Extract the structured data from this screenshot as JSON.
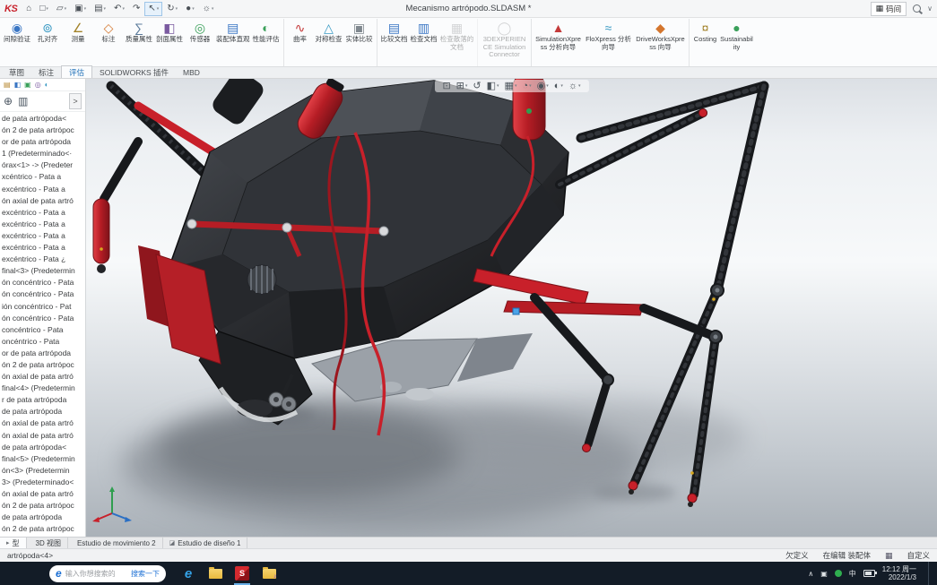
{
  "colors": {
    "accent_red": "#c8202a",
    "taskbar_bg": "#131c27",
    "selection_blue": "#4aa3e8"
  },
  "titlebar": {
    "logo": "KS",
    "title": "Mecanismo artrópodo.SLDASM *",
    "command_box": "码间",
    "keyboard_glyph": "▦",
    "search_chevron": "∨",
    "quick_icons": [
      {
        "name": "home-icon",
        "glyph": "⌂"
      },
      {
        "name": "new-document-icon",
        "glyph": "□",
        "caret": true
      },
      {
        "name": "open-icon",
        "glyph": "▱",
        "caret": true
      },
      {
        "name": "save-icon",
        "glyph": "▣",
        "caret": true
      },
      {
        "name": "print-icon",
        "glyph": "▤",
        "caret": true
      },
      {
        "name": "undo-icon",
        "glyph": "↶",
        "caret": true
      },
      {
        "name": "redo-icon",
        "glyph": "↷"
      },
      {
        "name": "select-icon",
        "glyph": "↖",
        "active": true,
        "caret": true
      },
      {
        "name": "rebuild-icon",
        "glyph": "↻",
        "caret": true
      },
      {
        "name": "appearance-sphere-icon",
        "glyph": "●",
        "caret": true
      },
      {
        "name": "options-gear-icon",
        "glyph": "☼",
        "caret": true
      }
    ]
  },
  "ribbon": {
    "buttons": [
      {
        "name": "ribbon-clearance-verification-button",
        "label": "间隙验证",
        "glyph": "◉",
        "color": "#3a76c4"
      },
      {
        "name": "ribbon-hole-alignment-button",
        "label": "孔对齐",
        "glyph": "⊚",
        "color": "#3a9ac4"
      },
      {
        "name": "ribbon-measure-button",
        "label": "测量",
        "glyph": "∠",
        "color": "#a3832a"
      },
      {
        "name": "ribbon-markup-button",
        "label": "标注",
        "glyph": "◇",
        "color": "#d4762e"
      },
      {
        "name": "ribbon-mass-properties-button",
        "label": "质量属性",
        "glyph": "∑",
        "color": "#5a7a9a"
      },
      {
        "name": "ribbon-section-properties-button",
        "label": "剖面属性",
        "glyph": "◧",
        "color": "#7a5aa0"
      },
      {
        "name": "ribbon-sensor-button",
        "label": "传感器",
        "glyph": "◎",
        "color": "#3aa05a"
      },
      {
        "name": "ribbon-assembly-visualization-button",
        "label": "装配体直观",
        "glyph": "▤",
        "color": "#3a76c4"
      },
      {
        "name": "ribbon-performance-evaluation-button",
        "label": "性能评估",
        "glyph": "◐",
        "color": "#3aa05a"
      },
      {
        "name": "ribbon-curvature-button",
        "label": "曲率",
        "glyph": "∿",
        "color": "#c43a3a",
        "sep": true
      },
      {
        "name": "ribbon-symmetry-check-button",
        "label": "对称检查",
        "glyph": "△",
        "color": "#3a9ac4"
      },
      {
        "name": "ribbon-compare-bodies-button",
        "label": "实体比较",
        "glyph": "▣",
        "color": "#80888f"
      },
      {
        "name": "ribbon-compare-documents-button",
        "label": "比较文档",
        "glyph": "▤",
        "color": "#3a76c4",
        "sep": true
      },
      {
        "name": "ribbon-check-document-button",
        "label": "检查文档",
        "glyph": "▥",
        "color": "#3a76c4"
      },
      {
        "name": "ribbon-check-scattered-documents-button",
        "label": "检查散落的文档",
        "glyph": "▦",
        "color": "#9aa0a6",
        "enabled": false
      },
      {
        "name": "ribbon-3dexperience-connector-button",
        "label": "3DEXPERIENCE Simulation Connector",
        "glyph": "◯",
        "color": "#9aa0a6",
        "enabled": false,
        "wide": true,
        "sep": true
      },
      {
        "name": "ribbon-simulationxpress-button",
        "label": "SimulationXpress 分析向导",
        "glyph": "▲",
        "color": "#c43a3a",
        "wide": true,
        "sep": true
      },
      {
        "name": "ribbon-floxpress-button",
        "label": "FloXpress 分析向导",
        "glyph": "≈",
        "color": "#3a9ac4",
        "wide": true
      },
      {
        "name": "ribbon-driveworksxpress-button",
        "label": "DriveWorksXpress 向导",
        "glyph": "◆",
        "color": "#d4762e",
        "wide": true
      },
      {
        "name": "ribbon-costing-button",
        "label": "Costing",
        "glyph": "¤",
        "color": "#a3832a",
        "sep": true
      },
      {
        "name": "ribbon-sustainability-button",
        "label": "Sustainability",
        "glyph": "●",
        "color": "#3aa05a"
      }
    ],
    "tabs": [
      {
        "name": "tab-sketch",
        "label": "草图"
      },
      {
        "name": "tab-markup",
        "label": "标注"
      },
      {
        "name": "tab-evaluate",
        "label": "评估",
        "active": true
      },
      {
        "name": "tab-solidworks-addins",
        "label": "SOLIDWORKS 插件"
      },
      {
        "name": "tab-mbd",
        "label": "MBD"
      }
    ]
  },
  "left_panel": {
    "manager_tabs": [
      {
        "name": "feature-manager-tab-icon",
        "glyph": "▤",
        "color": "#b5862e"
      },
      {
        "name": "property-manager-tab-icon",
        "glyph": "◧",
        "color": "#3a76c4"
      },
      {
        "name": "configuration-manager-tab-icon",
        "glyph": "▣",
        "color": "#3aa05a"
      },
      {
        "name": "dimxpert-manager-tab-icon",
        "glyph": "◎",
        "color": "#7a5aa0"
      },
      {
        "name": "display-manager-tab-icon",
        "glyph": "◐",
        "color": "#3a9ac4"
      }
    ],
    "tree_tools": [
      {
        "name": "tree-filter-icon",
        "glyph": "⊕"
      },
      {
        "name": "display-pane-icon",
        "glyph": "▥"
      }
    ],
    "collapse_chevron": ">",
    "tree_items": [
      "de pata artrópoda<",
      "ón 2 de pata artrópoc",
      "or de pata artrópoda",
      "1 (Predeterminado<·",
      "órax<1> -> (Predeter",
      "xcéntrico - Pata a",
      "excéntrico - Pata a",
      "ón axial de pata artró",
      "excéntrico - Pata a",
      "excéntrico - Pata a",
      "excéntrico - Pata a",
      "excéntrico - Pata a",
      "excéntrico - Pata ¿",
      "final<3> (Predetermin",
      "ón concéntrico - Pata",
      "ón concéntrico - Pata",
      "ión concéntrico - Pat",
      "ón concéntrico - Pata",
      "concéntrico - Pata",
      "oncéntrico - Pata",
      "or de pata artrópoda",
      "ón 2 de pata artrópoc",
      "ón axial de pata artró",
      "final<4> (Predetermin",
      "r de pata artrópoda",
      "de pata artrópoda",
      "ón axial de pata artró",
      "ón axial de pata artró",
      "de pata artrópoda<",
      "final<5> (Predetermin",
      "ón<3> (Predetermin",
      "3> (Predeterminado<",
      "ón axial de pata artró",
      "ón 2 de pata artrópoc",
      "de pata artrópoda",
      "ón 2 de pata artrópoc"
    ]
  },
  "viewport": {
    "hud_icons": [
      {
        "name": "zoom-fit-icon",
        "glyph": "⊡"
      },
      {
        "name": "zoom-area-icon",
        "glyph": "⊞",
        "caret": true
      },
      {
        "name": "previous-view-icon",
        "glyph": "↺"
      },
      {
        "name": "section-view-icon",
        "glyph": "◧",
        "caret": true
      },
      {
        "name": "view-orientation-icon",
        "glyph": "▦",
        "caret": true
      },
      {
        "name": "display-style-icon",
        "glyph": "◔",
        "caret": true
      },
      {
        "name": "hide-show-items-icon",
        "glyph": "◉",
        "caret": true
      },
      {
        "name": "edit-appearance-icon",
        "glyph": "◐",
        "caret": true
      },
      {
        "name": "apply-scene-icon",
        "glyph": "☼",
        "caret": true
      }
    ]
  },
  "doc_tabs": [
    {
      "name": "tab-model",
      "label": "型",
      "icon": "▸",
      "active": true
    },
    {
      "name": "tab-3d-views",
      "label": "3D 视图"
    },
    {
      "name": "tab-motion-study-2",
      "label": "Estudio de movimiento 2"
    },
    {
      "name": "tab-design-study-1",
      "label": "Estudio de diseño 1",
      "icon": "◪"
    }
  ],
  "status_bar": {
    "selection": "artrópoda<4>",
    "state": "欠定义",
    "mode": "在编辑 装配体",
    "grid_glyph": "▦",
    "customize": "自定义"
  },
  "taskbar": {
    "search_placeholder": "输入你想搜索的",
    "search_button": "搜索一下",
    "edge_glyph": "e",
    "tray_caret": "∧",
    "tray_app_glyph": "▣",
    "language": "中",
    "time": "12:12 周一",
    "date": "2022/1/3"
  }
}
